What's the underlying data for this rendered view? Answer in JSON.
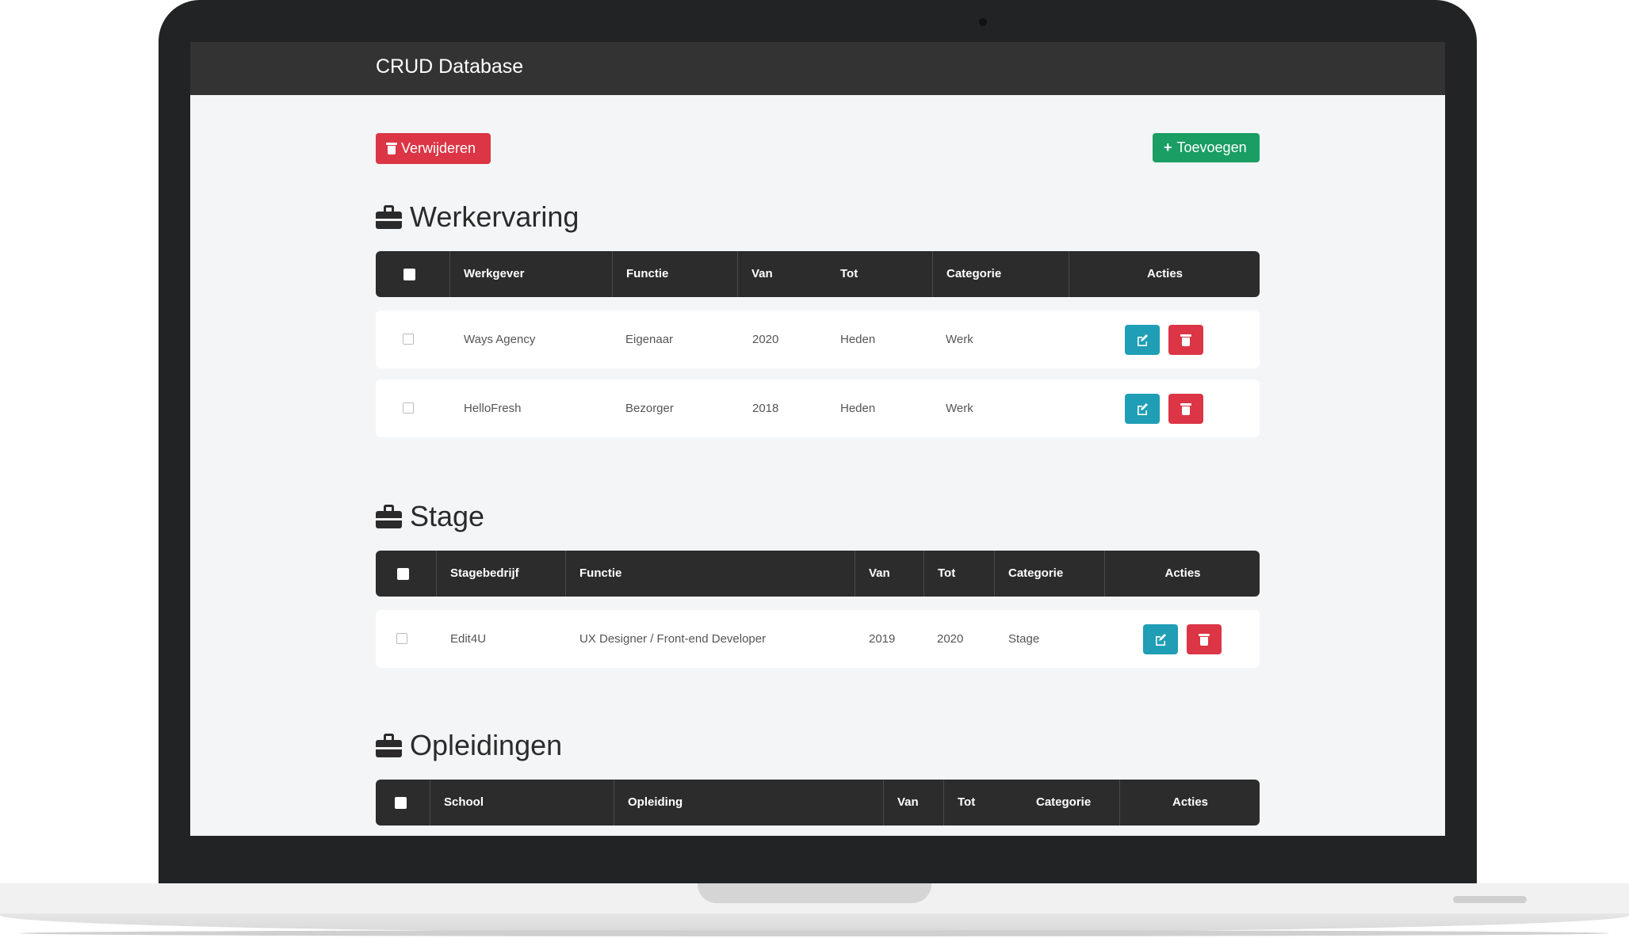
{
  "app": {
    "title": "CRUD Database"
  },
  "toolbar": {
    "delete_label": "Verwijderen",
    "add_label": "Toevoegen",
    "add_icon": "plus-icon",
    "delete_icon": "trash-icon"
  },
  "colors": {
    "navbar": "#333333",
    "danger": "#dc3545",
    "success": "#1a9e63",
    "info": "#1f9eb5",
    "table_header": "#2c2c2c"
  },
  "sections": [
    {
      "title": "Werkervaring",
      "icon": "briefcase-icon",
      "columns": [
        "Werkgever",
        "Functie",
        "Van",
        "Tot",
        "Categorie",
        "Acties"
      ],
      "rows": [
        [
          "Ways Agency",
          "Eigenaar",
          "2020",
          "Heden",
          "Werk"
        ],
        [
          "HelloFresh",
          "Bezorger",
          "2018",
          "Heden",
          "Werk"
        ]
      ]
    },
    {
      "title": "Stage",
      "icon": "briefcase-icon",
      "columns": [
        "Stagebedrijf",
        "Functie",
        "Van",
        "Tot",
        "Categorie",
        "Acties"
      ],
      "rows": [
        [
          "Edit4U",
          "UX Designer / Front-end Developer",
          "2019",
          "2020",
          "Stage"
        ]
      ]
    },
    {
      "title": "Opleidingen",
      "icon": "briefcase-icon",
      "columns": [
        "School",
        "Opleiding",
        "Van",
        "Tot",
        "Categorie",
        "Acties"
      ],
      "rows": []
    }
  ]
}
